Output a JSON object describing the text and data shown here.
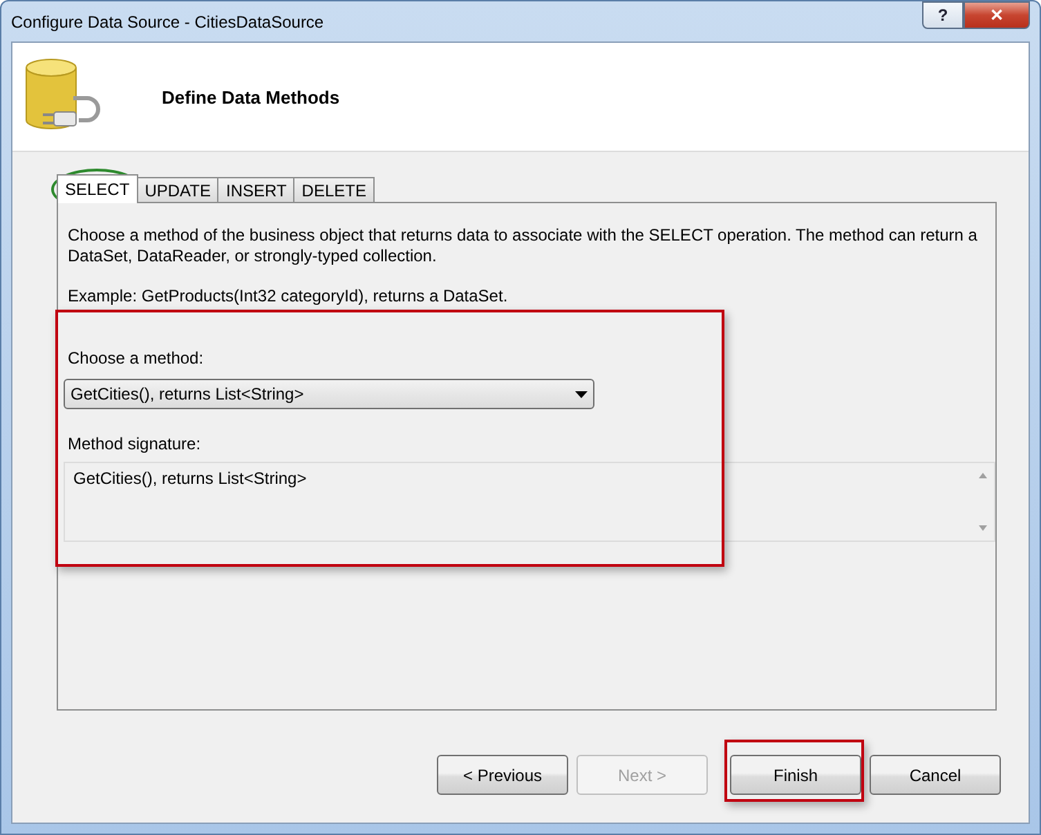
{
  "window": {
    "title": "Configure Data Source - CitiesDataSource",
    "help_button": "?",
    "close_button": "✕"
  },
  "header": {
    "title": "Define Data Methods"
  },
  "tabs": [
    {
      "label": "SELECT",
      "selected": true,
      "circled": true
    },
    {
      "label": "UPDATE",
      "selected": false,
      "circled": false
    },
    {
      "label": "INSERT",
      "selected": false,
      "circled": false
    },
    {
      "label": "DELETE",
      "selected": false,
      "circled": false
    }
  ],
  "panel": {
    "description": "Choose a method of the business object that returns data to associate with the SELECT operation. The method can return a DataSet, DataReader, or strongly-typed collection.",
    "example": "Example: GetProducts(Int32 categoryId), returns a DataSet.",
    "highlighted": true,
    "method_label": "Choose a method:",
    "method_value": "GetCities(), returns List<String>",
    "signature_label": "Method signature:",
    "signature_value": "GetCities(), returns List<String>"
  },
  "buttons": [
    {
      "label": "< Previous",
      "disabled": false,
      "highlighted": false
    },
    {
      "label": "Next >",
      "disabled": true,
      "highlighted": false
    },
    {
      "label": "Finish",
      "disabled": false,
      "highlighted": true
    },
    {
      "label": "Cancel",
      "disabled": false,
      "highlighted": false
    }
  ]
}
